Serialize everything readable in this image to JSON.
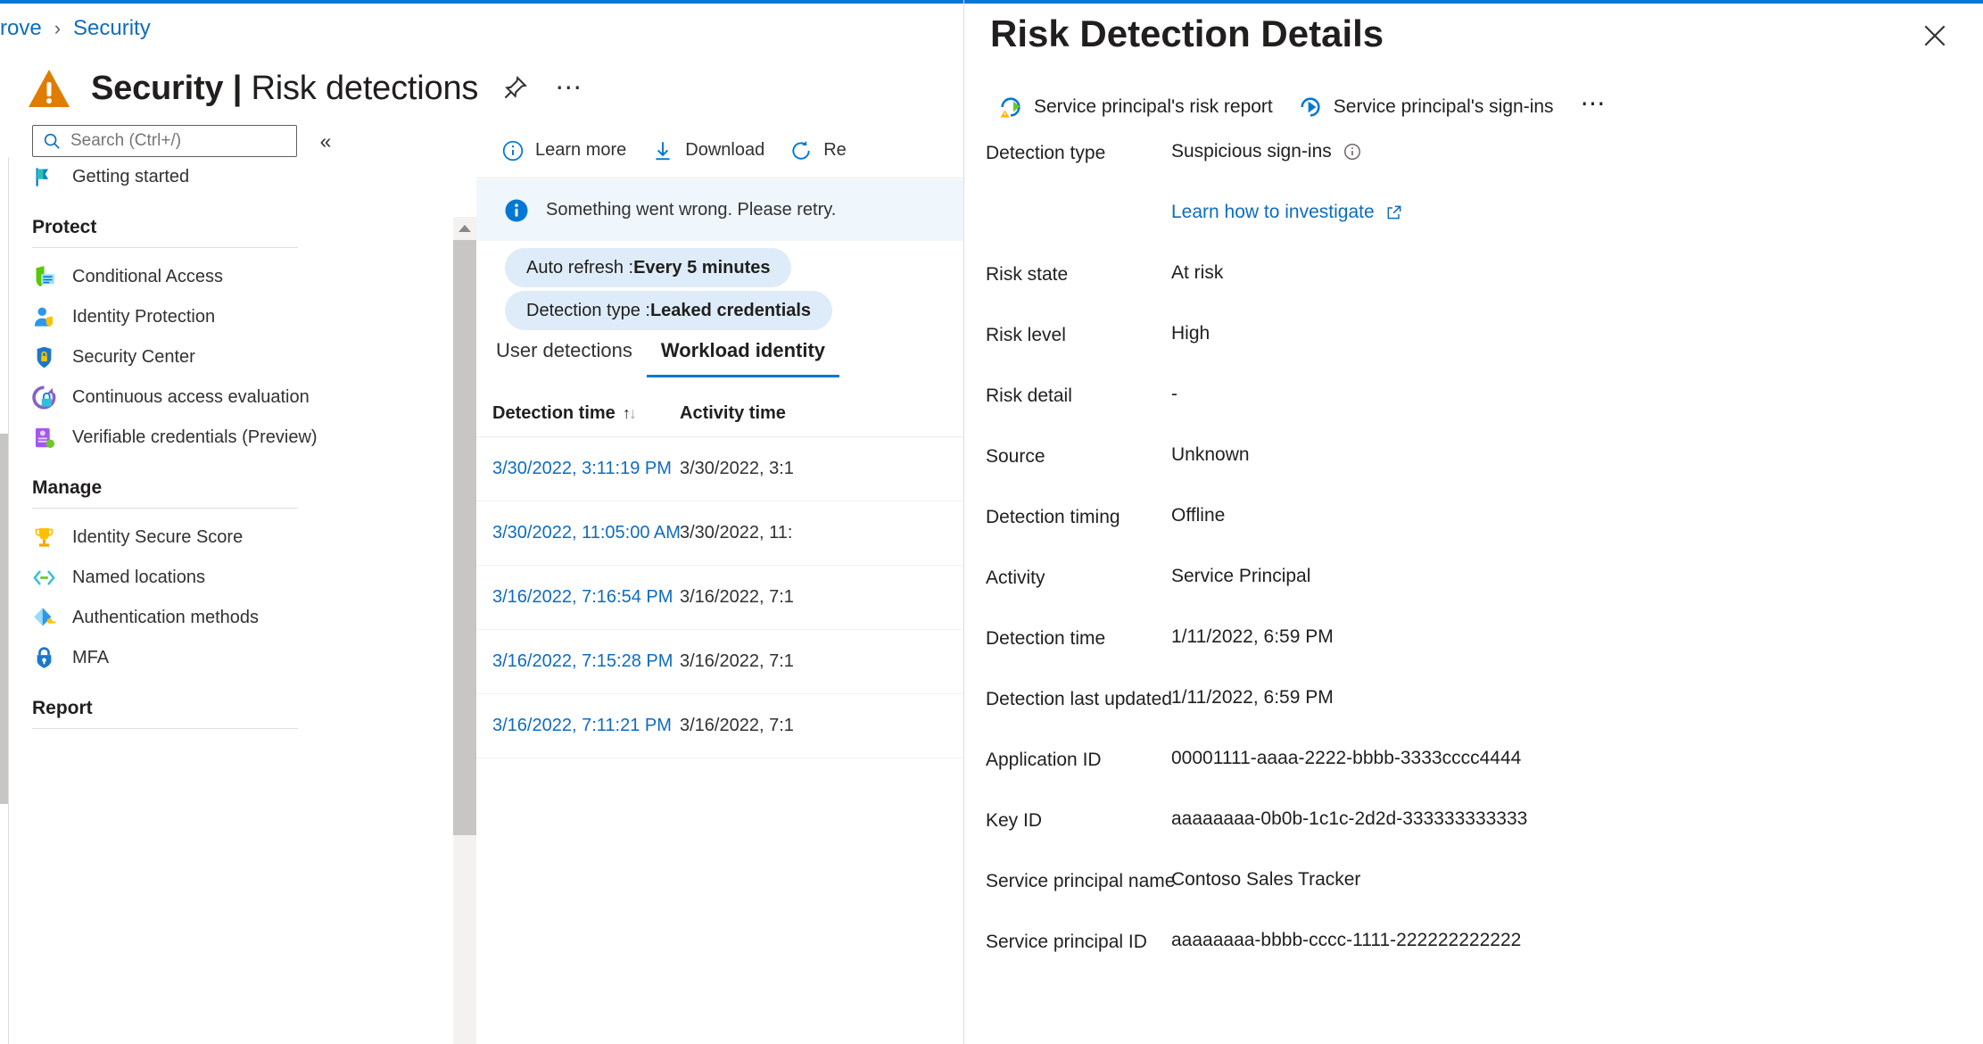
{
  "breadcrumb": {
    "items": [
      "rove",
      "Security"
    ],
    "separator": "›"
  },
  "header": {
    "title_main": "Security",
    "title_sep": " | ",
    "title_sub": "Risk detections",
    "pin_icon": "pin-icon",
    "more_icon": "ellipsis-icon"
  },
  "sidebar": {
    "search": {
      "placeholder": "Search (Ctrl+/)",
      "value": "",
      "icon": "search-icon"
    },
    "collapse_icon": "chevron-double-left-icon",
    "items_top": [
      {
        "label": "Getting started",
        "icon": "flag-icon"
      }
    ],
    "groups": [
      {
        "label": "Protect",
        "items": [
          {
            "label": "Conditional Access",
            "icon": "conditional-access-icon"
          },
          {
            "label": "Identity Protection",
            "icon": "identity-protection-icon"
          },
          {
            "label": "Security Center",
            "icon": "security-center-icon"
          },
          {
            "label": "Continuous access evaluation",
            "icon": "continuous-access-icon"
          },
          {
            "label": "Verifiable credentials (Preview)",
            "icon": "verifiable-credentials-icon"
          }
        ]
      },
      {
        "label": "Manage",
        "items": [
          {
            "label": "Identity Secure Score",
            "icon": "trophy-icon"
          },
          {
            "label": "Named locations",
            "icon": "named-locations-icon"
          },
          {
            "label": "Authentication methods",
            "icon": "authentication-methods-icon"
          },
          {
            "label": "MFA",
            "icon": "mfa-lock-icon"
          }
        ]
      },
      {
        "label": "Report",
        "items": []
      }
    ]
  },
  "main": {
    "commands": [
      {
        "label": "Learn more",
        "icon": "info-circle-icon"
      },
      {
        "label": "Download",
        "icon": "download-icon"
      },
      {
        "label": "Re",
        "icon": "refresh-icon"
      }
    ],
    "info_message": "Something went wrong. Please retry.",
    "info_icon": "info-filled-icon",
    "filters": [
      {
        "label": "Auto refresh : ",
        "value": "Every 5 minutes"
      },
      {
        "label": "Detection type : ",
        "value": "Leaked credentials"
      }
    ],
    "tabs": [
      {
        "label": "User detections",
        "active": false
      },
      {
        "label": "Workload identity",
        "active": true
      }
    ],
    "table": {
      "columns": [
        {
          "label": "Detection time",
          "sort": "asc"
        },
        {
          "label": "Activity time",
          "sort": "none"
        }
      ],
      "rows": [
        {
          "detection_time": "3/30/2022, 3:11:19 PM",
          "activity_time": "3/30/2022, 3:1"
        },
        {
          "detection_time": "3/30/2022, 11:05:00 AM",
          "activity_time": "3/30/2022, 11:"
        },
        {
          "detection_time": "3/16/2022, 7:16:54 PM",
          "activity_time": "3/16/2022, 7:1"
        },
        {
          "detection_time": "3/16/2022, 7:15:28 PM",
          "activity_time": "3/16/2022, 7:1"
        },
        {
          "detection_time": "3/16/2022, 7:11:21 PM",
          "activity_time": "3/16/2022, 7:1"
        }
      ]
    }
  },
  "panel": {
    "title": "Risk Detection Details",
    "close_icon": "close-icon",
    "commands": [
      {
        "label": "Service principal's risk report",
        "icon": "risk-report-icon"
      },
      {
        "label": "Service principal's sign-ins",
        "icon": "sign-ins-icon"
      }
    ],
    "more_icon": "ellipsis-icon",
    "details": [
      {
        "label": "Detection type",
        "value": "Suspicious sign-ins",
        "info_icon": "info-circle-icon"
      },
      {
        "label": "",
        "value": "Learn how to investigate",
        "link": true,
        "external_icon": "external-link-icon"
      },
      {
        "label": "Risk state",
        "value": "At risk"
      },
      {
        "label": "Risk level",
        "value": "High"
      },
      {
        "label": "Risk detail",
        "value": "-"
      },
      {
        "label": "Source",
        "value": "Unknown"
      },
      {
        "label": "Detection timing",
        "value": "Offline"
      },
      {
        "label": "Activity",
        "value": "Service Principal"
      },
      {
        "label": "Detection time",
        "value": "1/11/2022, 6:59 PM"
      },
      {
        "label": "Detection last updated",
        "value": "1/11/2022, 6:59 PM"
      },
      {
        "label": "Application ID",
        "value": "00001111-aaaa-2222-bbbb-3333cccc4444"
      },
      {
        "label": "Key ID",
        "value": "aaaaaaaa-0b0b-1c1c-2d2d-333333333333"
      },
      {
        "label": "Service principal name",
        "value": "Contoso Sales Tracker"
      },
      {
        "label": "Service principal ID",
        "value": "aaaaaaaa-bbbb-cccc-1111-222222222222"
      }
    ]
  },
  "colors": {
    "accent": "#0078d4",
    "link": "#0f6cbd",
    "warning": "#e07c00",
    "info_bg": "#eff6fc",
    "pill_bg": "#deecf9"
  }
}
